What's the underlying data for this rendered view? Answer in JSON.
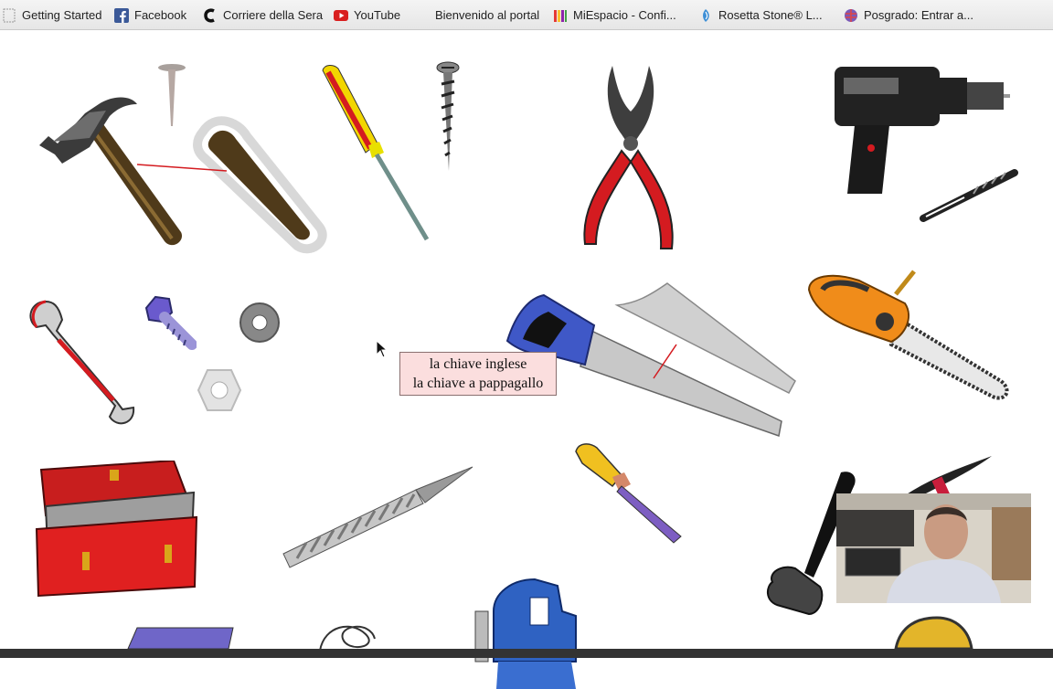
{
  "bookmarks": [
    {
      "label": "Getting Started",
      "icon": "page-icon"
    },
    {
      "label": "Facebook",
      "icon": "facebook-icon"
    },
    {
      "label": "Corriere della Sera",
      "icon": "corriere-icon"
    },
    {
      "label": "YouTube",
      "icon": "youtube-icon"
    },
    {
      "label": "Bienvenido al portal",
      "icon": ""
    },
    {
      "label": "MiEspacio - Confi...",
      "icon": "miespacio-icon"
    },
    {
      "label": "Rosetta Stone® L...",
      "icon": "rosetta-icon"
    },
    {
      "label": "Posgrado: Entrar a...",
      "icon": "globe-icon"
    }
  ],
  "tooltip": {
    "line1": "la chiave inglese",
    "line2": "la chiave a pappagallo"
  },
  "tools": [
    "hammer",
    "nail",
    "hammer-handle",
    "screwdriver",
    "screw",
    "pliers",
    "drill",
    "drill-bit",
    "wrench",
    "bolt",
    "washer",
    "nut",
    "saw",
    "saw-blade",
    "chainsaw",
    "toolbox",
    "file",
    "chisel",
    "mallet",
    "pickaxe",
    "vise",
    "rope",
    "book",
    "tape-measure"
  ],
  "colors": {
    "tooltip_bg": "#fbdede",
    "accent_red": "#d41b20",
    "handle_brown": "#5a4420"
  }
}
